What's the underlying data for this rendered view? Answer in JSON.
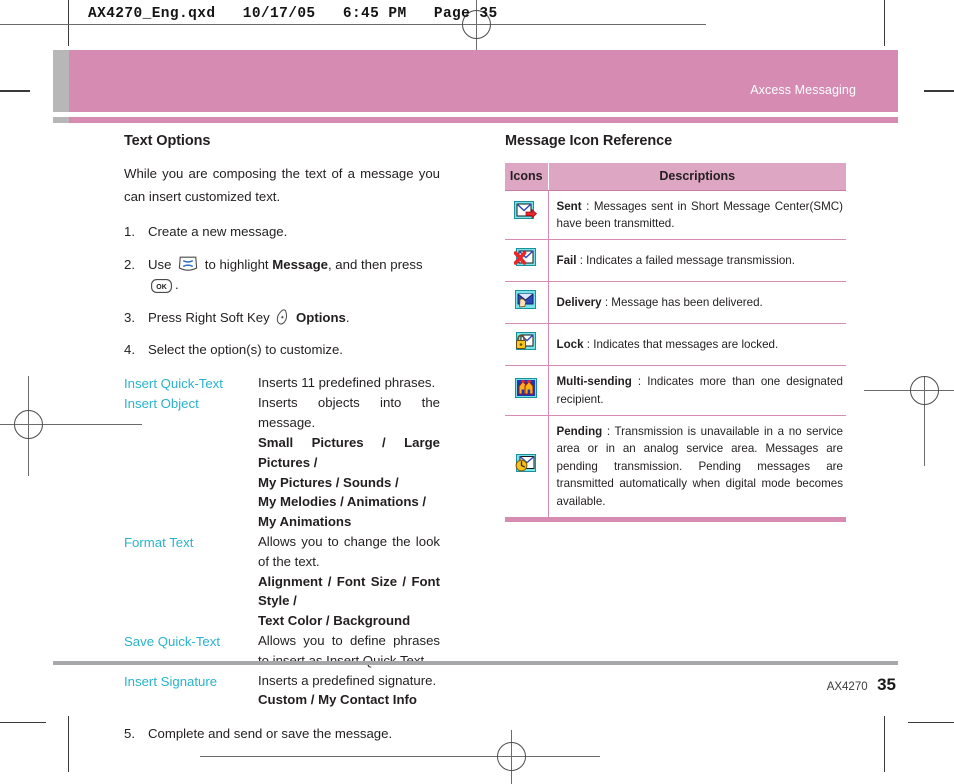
{
  "print_header": "AX4270_Eng.qxd   10/17/05   6:45 PM   Page 35",
  "banner": {
    "title": "Axcess Messaging",
    "pink": "#d68bb2",
    "gray": "#b7b7b7"
  },
  "left_column": {
    "section_title": "Text Options",
    "intro": "While you are composing the text of a message you can insert customized text.",
    "steps": [
      {
        "num": "1.",
        "text": "Create a new message."
      },
      {
        "num": "2.",
        "pre": "Use",
        "icon1": "nav-key-icon",
        "mid": "to highlight",
        "bold": "Message",
        "mid2": ", and then press",
        "icon2": "ok-key-icon",
        "post": "."
      },
      {
        "num": "3.",
        "pre": "Press Right Soft Key",
        "icon1": "right-soft-key-icon",
        "bold": "Options",
        "post": "."
      },
      {
        "num": "4.",
        "text": "Select the option(s) to customize."
      }
    ],
    "options": [
      {
        "name": "Insert Quick-Text",
        "desc": "Inserts 11 predefined phrases.",
        "values": []
      },
      {
        "name": "Insert Object",
        "desc": "Inserts objects into the message.",
        "values": [
          "Small Pictures / Large Pictures /",
          "My Pictures / Sounds /",
          "My Melodies / Animations /",
          "My Animations"
        ]
      },
      {
        "name": "Format Text",
        "desc": "Allows you to change the look of the text.",
        "values": [
          "Alignment / Font Size / Font Style /",
          "Text Color / Background"
        ]
      },
      {
        "name": "Save Quick-Text",
        "desc": "Allows you to define phrases to insert as Insert Quick Text.",
        "values": []
      },
      {
        "name": "Insert Signature",
        "desc": "Inserts a predefined signature.",
        "values": [
          "Custom / My Contact Info"
        ]
      }
    ],
    "final_step": {
      "num": "5.",
      "text": "Complete and send or save the message."
    },
    "link_color": "#29b3cc"
  },
  "right_column": {
    "section_title": "Message Icon Reference",
    "table": {
      "headers": [
        "Icons",
        "Descriptions"
      ],
      "rows": [
        {
          "icon": "sent-envelope-icon",
          "term": "Sent",
          "sep": " : ",
          "desc": "Messages sent in Short Message Center(SMC) have been transmitted."
        },
        {
          "icon": "fail-envelope-icon",
          "term": "Fail",
          "sep": " : ",
          "desc": "Indicates a failed message transmission."
        },
        {
          "icon": "delivery-envelope-icon",
          "term": "Delivery",
          "sep": " : ",
          "desc": "Message has been delivered."
        },
        {
          "icon": "lock-envelope-icon",
          "term": "Lock",
          "sep": " : ",
          "desc": "Indicates that messages are locked."
        },
        {
          "icon": "multi-sending-icon",
          "term": "Multi-sending",
          "sep": " : ",
          "desc": "Indicates more than one designated recipient."
        },
        {
          "icon": "pending-clock-icon",
          "term": "Pending",
          "sep": " : ",
          "desc": "Transmission is unavailable in a no service area or in an analog service area. Messages are pending transmission. Pending messages are transmitted automatically when digital mode becomes available."
        }
      ]
    }
  },
  "footer": {
    "model": "AX4270",
    "page": "35"
  }
}
